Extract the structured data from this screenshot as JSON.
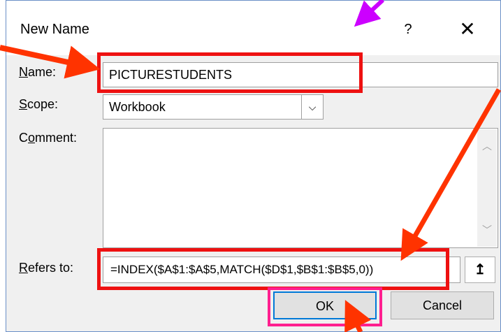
{
  "dialog": {
    "title": "New Name",
    "help_label": "?",
    "close_label": "✕",
    "name_label": {
      "access_key": "N",
      "rest": "ame:"
    },
    "name_value": "PICTURESTUDENTS",
    "scope_label": {
      "access_key": "S",
      "rest": "cope:"
    },
    "scope_value": "Workbook",
    "comment_label": {
      "pre": "C",
      "access_key": "o",
      "rest": "mment:"
    },
    "comment_value": "",
    "refers_label": {
      "access_key": "R",
      "rest": "efers to:"
    },
    "refers_value": "=INDEX($A$1:$A$5,MATCH($D$1,$B$1:$B$5,0))",
    "collapse_icon": "↥",
    "ok_label": "OK",
    "cancel_label": "Cancel"
  },
  "colors": {
    "highlight_red": "#ee1111",
    "highlight_pink": "#ff1f8f",
    "arrow_red": "#ff3300",
    "arrow_purple": "#cc00ff"
  }
}
